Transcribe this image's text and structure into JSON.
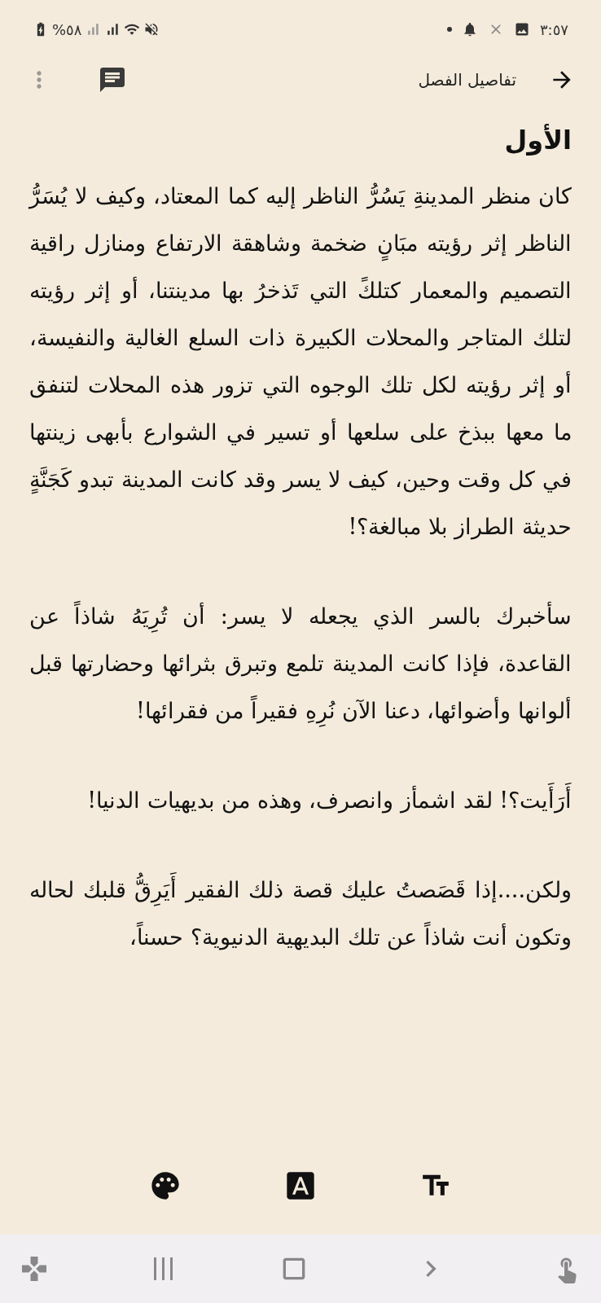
{
  "status_bar": {
    "time": "٣:٥٧",
    "battery": "%٥٨"
  },
  "header": {
    "title": "تفاصيل الفصل"
  },
  "chapter": {
    "heading": "الأول",
    "paragraphs": [
      "كان منظر المدينةِ يَسُرُّ الناظر إليه كما المعتاد، وكيف لا يُسَرُّ الناظر إثر رؤيته مبَانٍ ضخمة وشاهقة الارتفاع ومنازل راقية التصميم والمعمار كتلكً التي تَذخرُ بها مدينتنا، أو إثر رؤيته لتلك المتاجر والمحلات الكبيرة ذات السلع الغالية والنفيسة، أو إثر رؤيته لكل تلك الوجوه التي تزور هذه المحلات لتنفق ما معها ببذخ على سلعها أو تسير في الشوارع بأبهى زينتها في كل وقت وحين، كيف لا يسر وقد كانت المدينة تبدو كَجَنَّةٍ حديثة الطراز بلا مبالغة؟!",
      "سأخبرك بالسر الذي يجعله لا يسر: أن تُرِيَهُ شاذاً عن القاعدة، فإذا كانت المدينة تلمع وتبرق بثرائها وحضارتها قبل ألوانها وأضوائها، دعنا الآن نُرِهِ فقيراً من فقرائها!",
      "أَرَأَيت؟! لقد اشمأز وانصرف، وهذه من بديهيات الدنيا!",
      "ولكن....إذا قَصَصتُ عليك قصة ذلك الفقير أَيَرِقُّ قلبك لحاله وتكون أنت شاذاً عن تلك البديهية الدنيوية؟ حسناً،"
    ]
  }
}
